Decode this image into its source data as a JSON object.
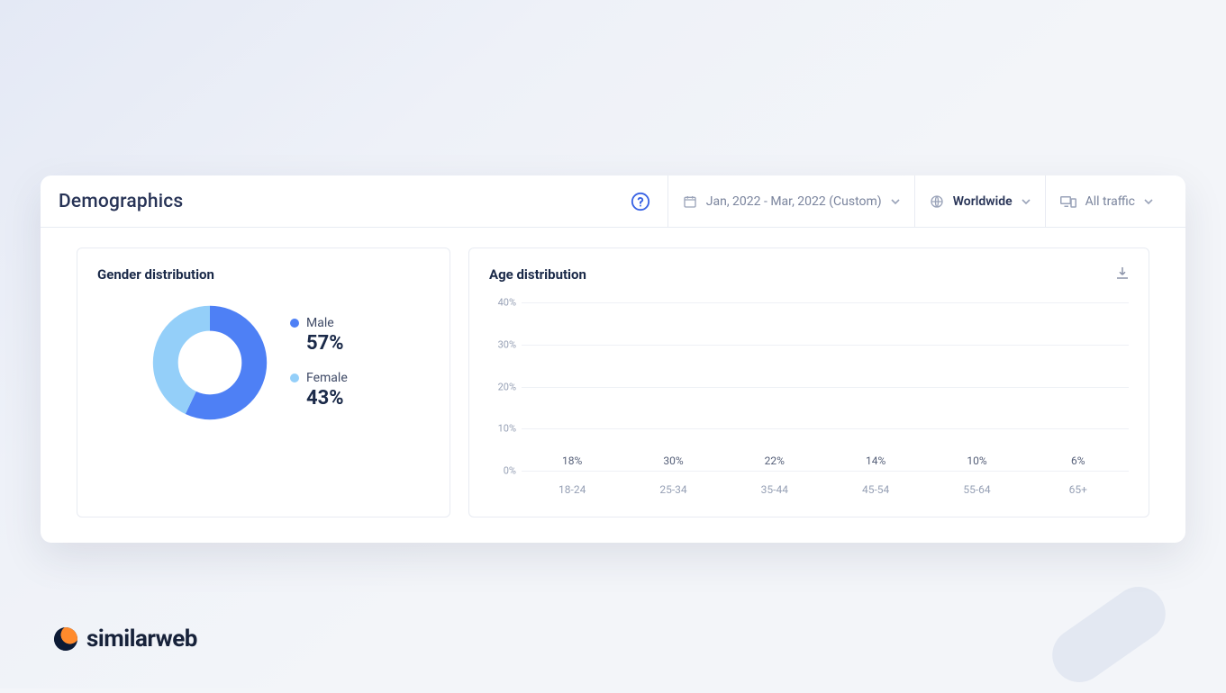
{
  "header": {
    "title": "Demographics"
  },
  "filters": {
    "date_label": "Jan, 2022 - Mar, 2022 (Custom)",
    "region_label": "Worldwide",
    "traffic_label": "All traffic"
  },
  "gender_card": {
    "title": "Gender distribution",
    "male_label": "Male",
    "female_label": "Female",
    "male_value": "57%",
    "female_value": "43%"
  },
  "age_card": {
    "title": "Age distribution"
  },
  "brand": {
    "name": "similarweb"
  },
  "chart_data": [
    {
      "type": "pie",
      "title": "Gender distribution",
      "series": [
        {
          "name": "Male",
          "value": 57,
          "color": "#4e80f5"
        },
        {
          "name": "Female",
          "value": 43,
          "color": "#94cff9"
        }
      ]
    },
    {
      "type": "bar",
      "title": "Age distribution",
      "categories": [
        "18-24",
        "25-34",
        "35-44",
        "45-54",
        "55-64",
        "65+"
      ],
      "values": [
        18,
        30,
        22,
        14,
        10,
        6
      ],
      "ylabel": "",
      "xlabel": "",
      "ylim": [
        0,
        40
      ],
      "yticks": [
        0,
        10,
        20,
        30,
        40
      ],
      "bar_color": "#6895f1"
    }
  ]
}
